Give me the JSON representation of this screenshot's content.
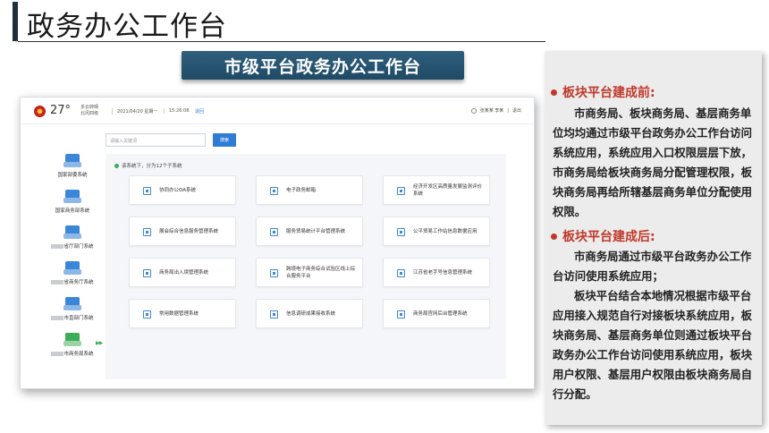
{
  "slide": {
    "title": "政务办公工作台",
    "banner": "市级平台政务办公工作台"
  },
  "screenshot": {
    "header": {
      "temperature": "27°",
      "weather_line1": "多云转晴",
      "weather_line2": "北风四级",
      "date": "2021/04/20 星期一",
      "time": "15:26:08",
      "back_label": "退回",
      "user_name": "张某某 李某",
      "logout_label": "退出"
    },
    "search": {
      "placeholder": "请输入关键词",
      "button_label": "搜索"
    },
    "nav_items": [
      {
        "label": "国家部委系统",
        "redacted": false,
        "active": false
      },
      {
        "label": "国家商务部系统",
        "redacted": false,
        "active": false
      },
      {
        "label": "省厅部门系统",
        "redacted": true,
        "active": false
      },
      {
        "label": "省商务厅系统",
        "redacted": true,
        "active": false
      },
      {
        "label": "市直部门系统",
        "redacted": true,
        "active": false
      },
      {
        "label": "市商务局系统",
        "redacted": true,
        "active": true
      }
    ],
    "content_note": "该系统下，分为12个子系统",
    "tiles": [
      "协同办公OA系统",
      "电子政务邮箱",
      "经济开发区高质量发展监测评价系统",
      "展会综合信息服务管理系统",
      "服务贸易统计平台管理系统",
      "公平贸易工作站信息数据应用",
      "商务局出入境管理系统",
      "跨境电子商务综合试验区线上综合服务平台",
      "江苏省老字号信息管理系统",
      "常用数据管理系统",
      "信息调研成果接收系统",
      "商务局官网后台管理系统"
    ]
  },
  "right_panel": {
    "before_heading": "板块平台建成前:",
    "before_text": "市商务局、板块商务局、基层商务单位均均通过市级平台政务办公工作台访问系统应用，系统应用入口权限层层下放，市商务局给板块商务局分配管理权限，板块商务局再给所辖基层商务单位分配使用权限。",
    "after_heading": "板块平台建成后:",
    "after_text_1": "市商务局通过市级平台政务办公工作台访问使用系统应用；",
    "after_text_2": "板块平台结合本地情况根据市级平台应用接入规范自行对接板块系统应用，板块商务局、基层商务单位则通过板块平台政务办公工作台访问使用系统应用，板块用户权限、基层用户权限由板块商务局自行分配。"
  },
  "colors": {
    "banner": "#2f5f7d",
    "accent_red": "#c0392b",
    "link_blue": "#2e7cd6",
    "active_green": "#3cae57"
  }
}
